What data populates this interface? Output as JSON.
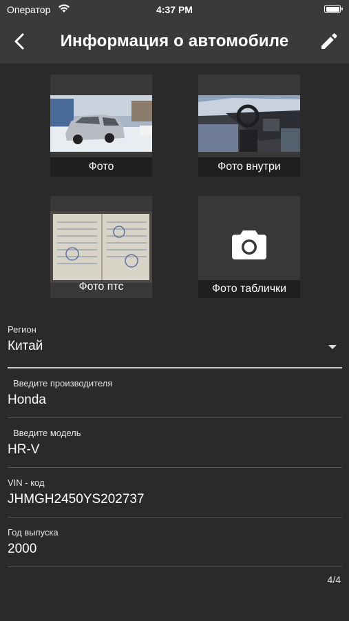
{
  "status_bar": {
    "carrier": "Оператор",
    "time": "4:37 PM"
  },
  "nav": {
    "title": "Информация о автомобиле",
    "back_icon": "chevron-left-icon",
    "edit_icon": "pencil-icon"
  },
  "photos": [
    {
      "caption": "Фото"
    },
    {
      "caption": "Фото внутри"
    },
    {
      "caption": "Фото птс"
    },
    {
      "caption": "Фото таблички",
      "icon": "camera-icon"
    }
  ],
  "form": {
    "region": {
      "label": "Регион",
      "value": "Китай"
    },
    "manufacturer": {
      "label": "Введите производителя",
      "value": "Honda"
    },
    "model": {
      "label": "Введите модель",
      "value": "HR-V"
    },
    "vin": {
      "label": "VIN - код",
      "value": "JHMGH2450YS202737"
    },
    "year": {
      "label": "Год выпуска",
      "value": "2000"
    }
  },
  "page_counter": "4/4",
  "colors": {
    "background": "#2a2a2a",
    "bar": "#3a3a3a",
    "tile": "#383838"
  }
}
